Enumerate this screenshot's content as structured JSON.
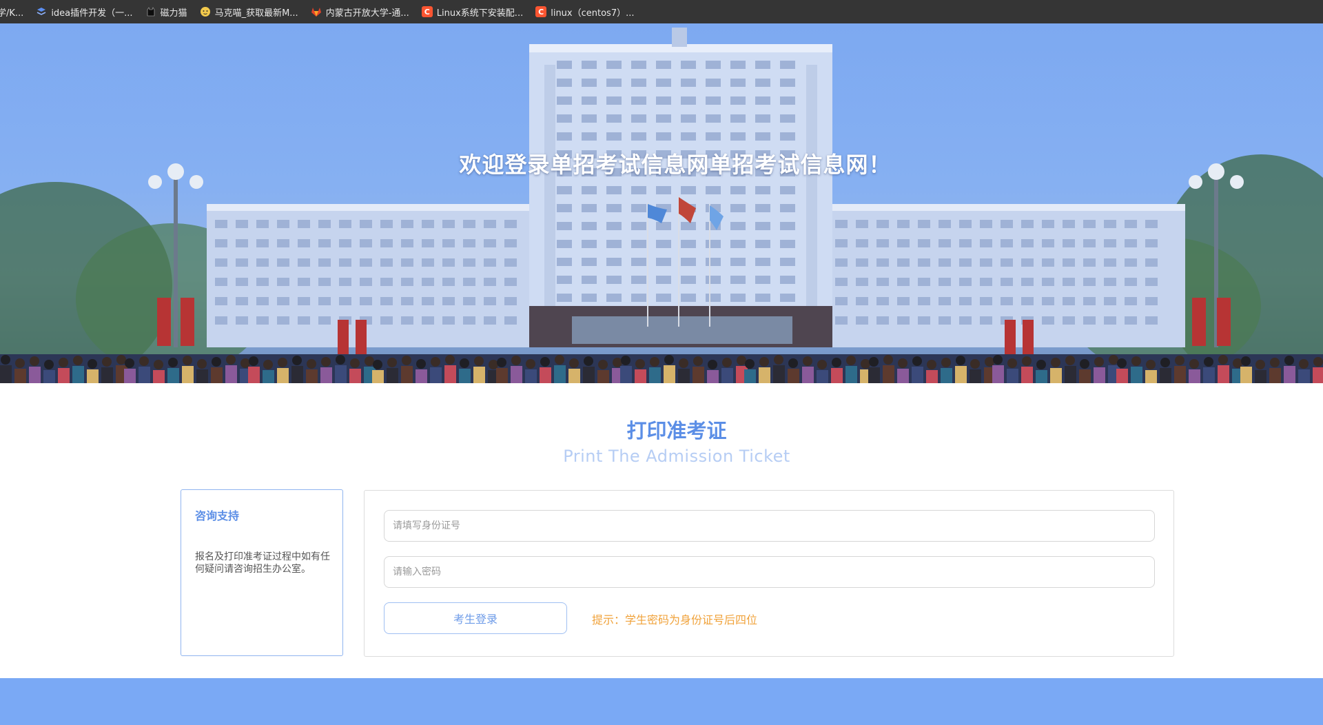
{
  "bookmarks": [
    {
      "label": "学/K...",
      "icon": "page-icon",
      "color": "#353535"
    },
    {
      "label": "idea插件开发（一...",
      "icon": "layers-icon",
      "color": "#5b8ef0"
    },
    {
      "label": "磁力猫",
      "icon": "cat-icon",
      "color": "#111111"
    },
    {
      "label": "马克喵_获取最新M...",
      "icon": "cat-face-icon",
      "color": "#f2c94c"
    },
    {
      "label": "内蒙古开放大学-通...",
      "icon": "gitlab-icon",
      "color": "#e24329"
    },
    {
      "label": "Linux系统下安装配...",
      "icon": "csdn-icon",
      "color": "#fc5531"
    },
    {
      "label": "linux（centos7）...",
      "icon": "csdn-icon",
      "color": "#fc5531"
    }
  ],
  "banner": {
    "title": "欢迎登录单招考试信息网单招考试信息网！"
  },
  "main": {
    "title": "打印准考证",
    "subtitle": "Print The Admission Ticket",
    "support": {
      "title": "咨询支持",
      "text": "报名及打印准考证过程中如有任何疑问请咨询招生办公室。"
    },
    "form": {
      "id_placeholder": "请填写身份证号",
      "password_placeholder": "请输入密码",
      "login_label": "考生登录",
      "hint": "提示：学生密码为身份证号后四位"
    }
  },
  "colors": {
    "accent": "#5b8ee6",
    "hint": "#f0a23a",
    "footer": "#7aa9f5"
  }
}
